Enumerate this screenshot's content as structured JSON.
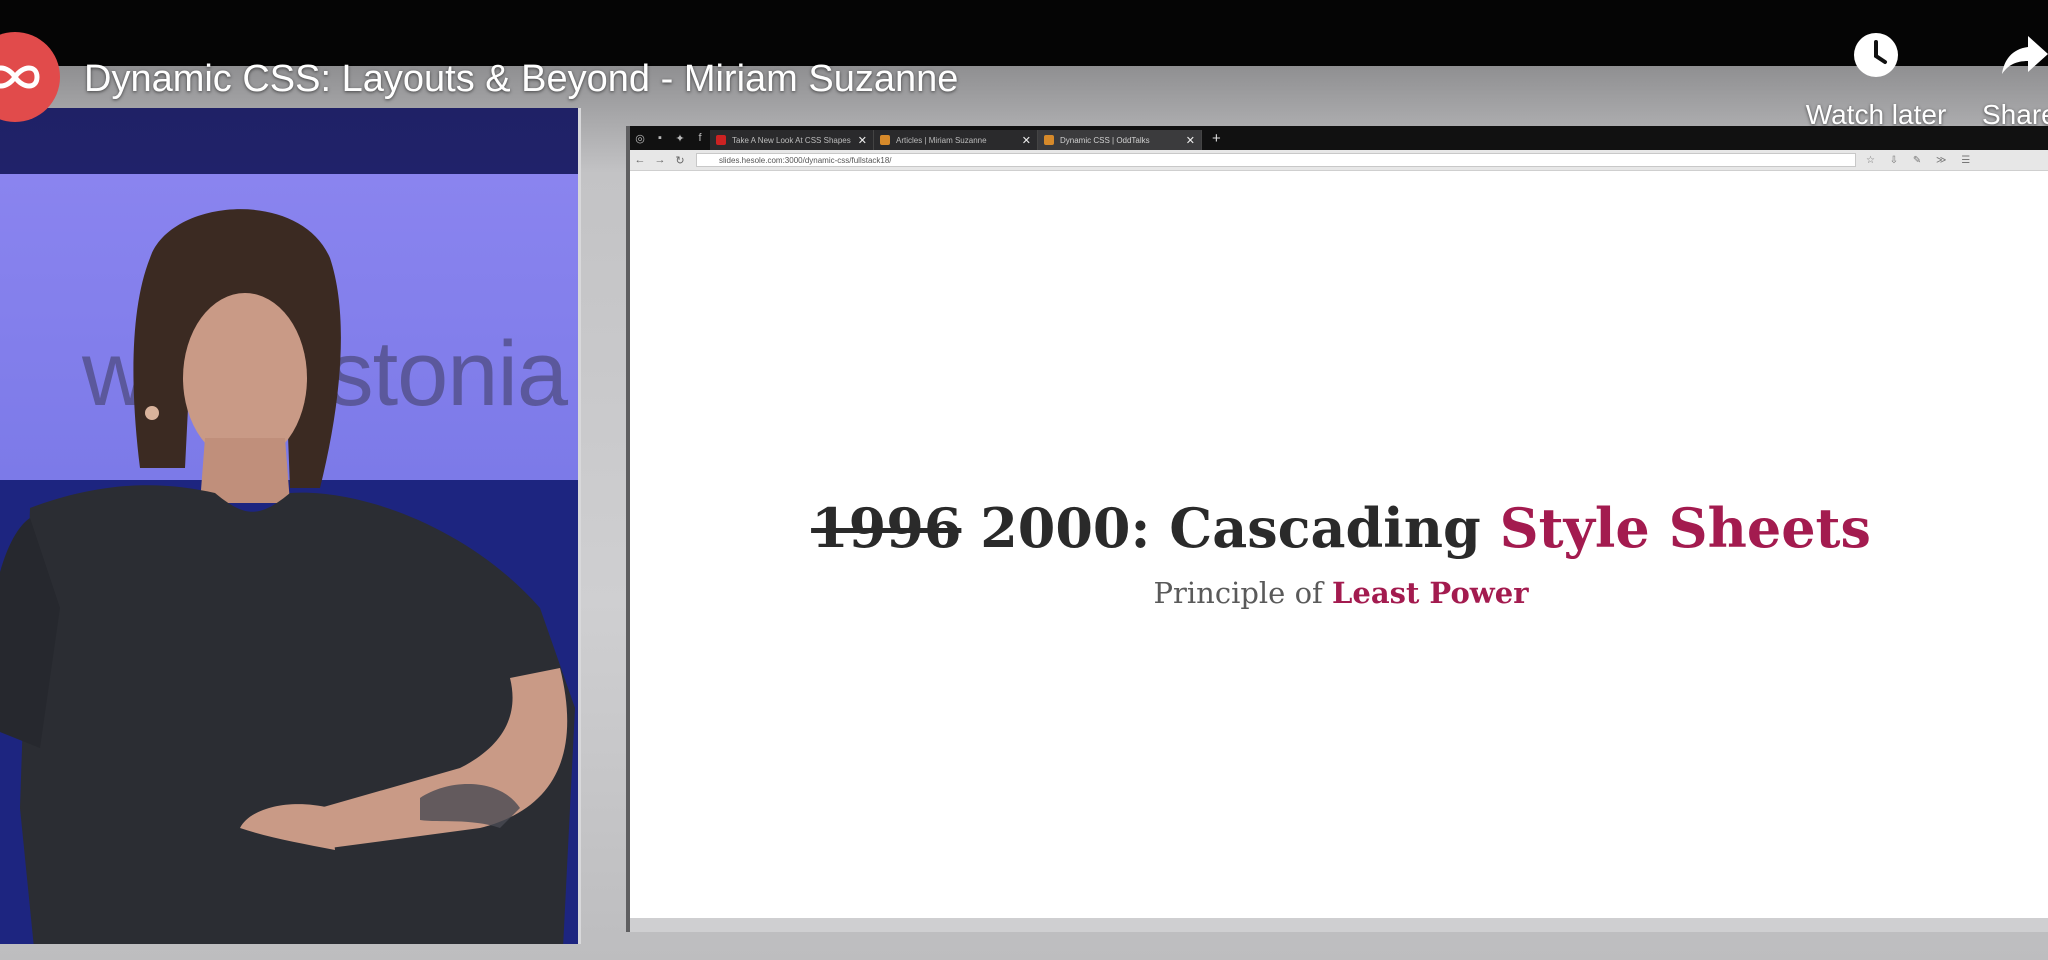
{
  "video": {
    "title": "Dynamic CSS: Layouts & Beyond - Miriam Suzanne",
    "channel_avatar_icon": "infinity-logo-icon",
    "brand_color": "#e14b4b"
  },
  "controls": {
    "watch_later_label": "Watch later",
    "watch_later_icon": "clock-icon",
    "share_label": "Share",
    "share_icon": "share-arrow-icon"
  },
  "stage": {
    "sign_text": "wordestonia"
  },
  "browser": {
    "tabs": [
      {
        "label": "Take A New Look At CSS Shapes"
      },
      {
        "label": "Articles | Miriam Suzanne"
      },
      {
        "label": "Dynamic CSS | OddTalks"
      }
    ],
    "url": "slides.hesole.com:3000/dynamic-css/fullstack18/"
  },
  "slide": {
    "struck_year": "1996",
    "year": "2000:",
    "heading_main": "Cascading",
    "heading_accent": "Style Sheets",
    "subtitle_main": "Principle of",
    "subtitle_accent": "Least Power",
    "accent_color": "#a31b4f"
  }
}
